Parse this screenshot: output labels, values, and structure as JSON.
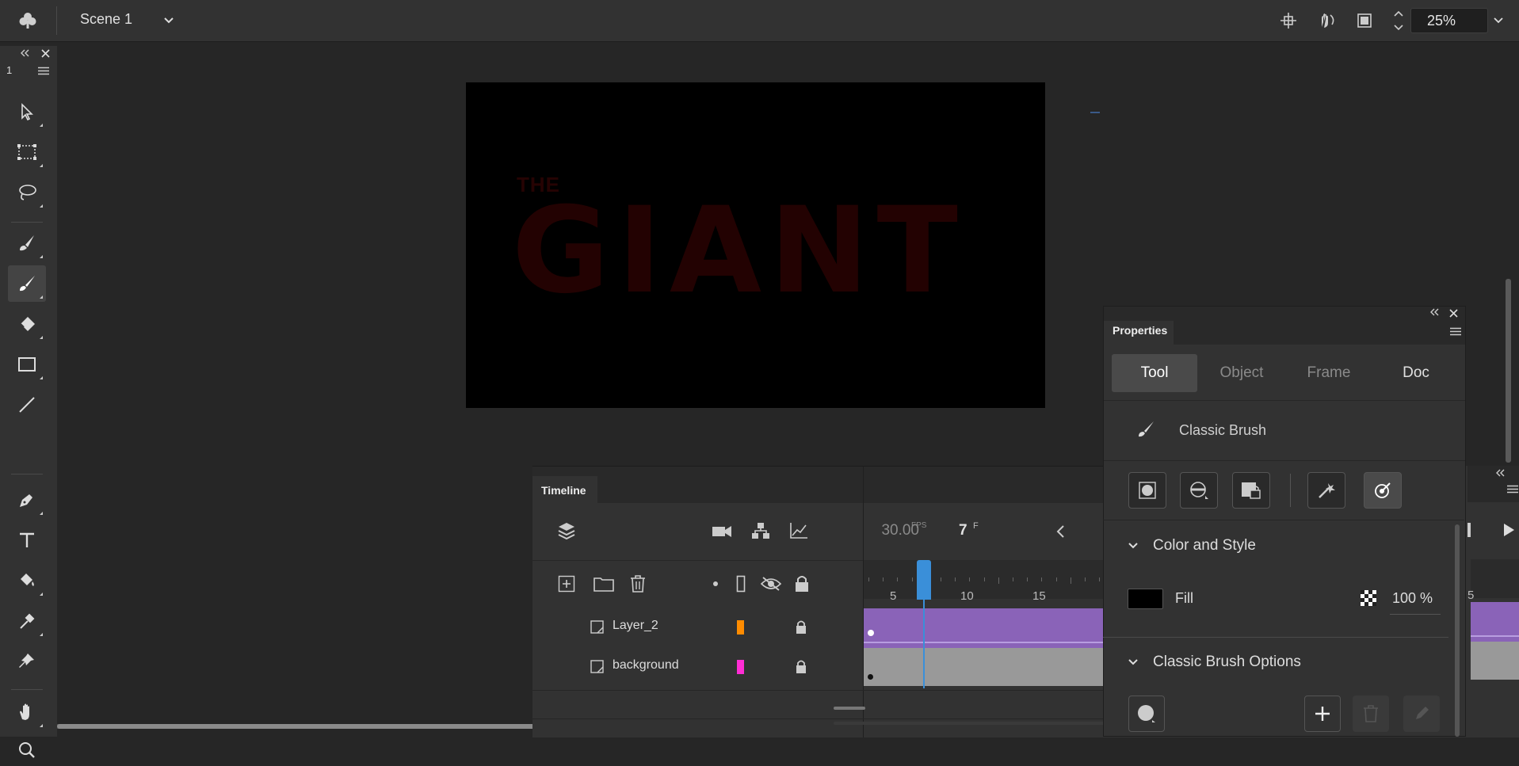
{
  "topbar": {
    "scene_label": "Scene 1",
    "zoom_value": "25%",
    "icons": [
      "club-icon",
      "chevron-down-icon",
      "snap-icon",
      "rotate-stage-icon",
      "clip-icon",
      "stepper-icon",
      "chevron-down-icon"
    ]
  },
  "toolbar": {
    "panel_number": "1",
    "tools": [
      "selection-tool",
      "free-transform-tool",
      "lasso-tool",
      "paint-brush-tool",
      "classic-brush-tool",
      "eraser-tool",
      "rectangle-tool",
      "line-tool",
      "pen-tool",
      "text-tool",
      "paint-bucket-tool",
      "eyedropper-tool",
      "asset-warp-tool",
      "hand-tool",
      "zoom-tool"
    ],
    "active_tool": "classic-brush-tool"
  },
  "stage": {
    "artwork_small_text": "THE",
    "artwork_title": "GIANT",
    "background": "#000000",
    "artwork_color": "#230202"
  },
  "timeline": {
    "tab_label": "Timeline",
    "fps": "30.00",
    "fps_unit": "FPS",
    "current_frame": "7",
    "frame_unit": "F",
    "ruler_labels": [
      "5",
      "10",
      "15"
    ],
    "layers": [
      {
        "name": "Layer_2",
        "color": "#ff8c00"
      },
      {
        "name": "background",
        "color": "#ff2dd4"
      }
    ],
    "frame_color_layer": "#8a63b8",
    "frame_color_background": "#999999",
    "playhead_color": "#3a8fd9"
  },
  "properties": {
    "panel_title": "Properties",
    "tabs": [
      "Tool",
      "Object",
      "Frame",
      "Doc"
    ],
    "active_tab": "Tool",
    "tool_name": "Classic Brush",
    "section_color_style": "Color and Style",
    "fill_label": "Fill",
    "fill_color": "#000000",
    "fill_alpha": "100 %",
    "section_brush_options": "Classic Brush Options"
  }
}
